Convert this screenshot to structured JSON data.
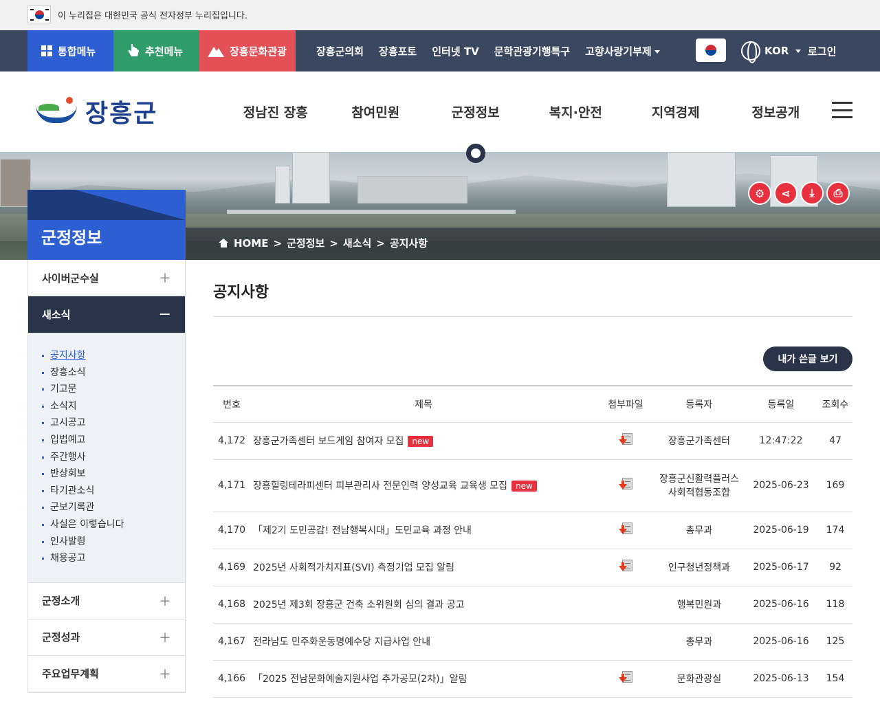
{
  "gov_banner": {
    "text": "이 누리집은 대한민국 공식 전자정부 누리집입니다."
  },
  "topbar": {
    "quick": [
      "통합메뉴",
      "추천메뉴",
      "장흥문화관광"
    ],
    "links": [
      "장흥군의회",
      "장흥포토",
      "인터넷 TV",
      "문학관광기행특구",
      "고향사랑기부제"
    ],
    "lang": "KOR",
    "login": "로그인"
  },
  "header": {
    "logo": "장흥군",
    "gnb": [
      "정남진 장흥",
      "참여민원",
      "군정정보",
      "복지·안전",
      "지역경제",
      "정보공개"
    ]
  },
  "visual": {
    "section_title": "군정정보",
    "util_icons": [
      "gear-icon",
      "share-icon",
      "download-icon",
      "print-icon"
    ],
    "breadcrumb": [
      "HOME",
      "군정정보",
      "새소식",
      "공지사항"
    ]
  },
  "sidebar": {
    "items_top": [
      "사이버군수실"
    ],
    "active": "새소식",
    "sub": [
      "공지사항",
      "장흥소식",
      "기고문",
      "소식지",
      "고시공고",
      "입법예고",
      "주간행사",
      "반상회보",
      "타기관소식",
      "군보기록관",
      "사실은 이렇습니다",
      "인사발령",
      "채용공고"
    ],
    "items_bottom": [
      "군정소개",
      "군정성과",
      "주요업무계획"
    ]
  },
  "content": {
    "title": "공지사항",
    "my_posts": "내가 쓴글 보기",
    "columns": [
      "번호",
      "제목",
      "첨부파일",
      "등록자",
      "등록일",
      "조회수"
    ],
    "rows": [
      {
        "no": "4,172",
        "title": "장흥군가족센터 보드게임 참여자 모집",
        "new": "new",
        "file": true,
        "author": "장흥군가족센터",
        "date": "12:47:22",
        "views": "47"
      },
      {
        "no": "4,171",
        "title": "장흥힐링테라피센터 피부관리사 전문인력 양성교육 교육생 모집",
        "new": "new",
        "file": true,
        "author": "장흥군신활력플러스 사회적협동조합",
        "date": "2025-06-23",
        "views": "169"
      },
      {
        "no": "4,170",
        "title": "「제2기 도민공감! 전남행복시대」도민교육 과정 안내",
        "new": "",
        "file": true,
        "author": "총무과",
        "date": "2025-06-19",
        "views": "174"
      },
      {
        "no": "4,169",
        "title": "2025년 사회적가치지표(SVI) 측정기업 모집 알림",
        "new": "",
        "file": true,
        "author": "인구청년정책과",
        "date": "2025-06-17",
        "views": "92"
      },
      {
        "no": "4,168",
        "title": "2025년 제3회 장흥군 건축 소위원회 심의 결과 공고",
        "new": "",
        "file": false,
        "author": "행복민원과",
        "date": "2025-06-16",
        "views": "118"
      },
      {
        "no": "4,167",
        "title": "전라남도 민주화운동명예수당 지급사업 안내",
        "new": "",
        "file": false,
        "author": "총무과",
        "date": "2025-06-16",
        "views": "125"
      },
      {
        "no": "4,166",
        "title": "「2025 전남문화예술지원사업 추가공모(2차)」알림",
        "new": "",
        "file": true,
        "author": "문화관광실",
        "date": "2025-06-13",
        "views": "154"
      }
    ]
  }
}
